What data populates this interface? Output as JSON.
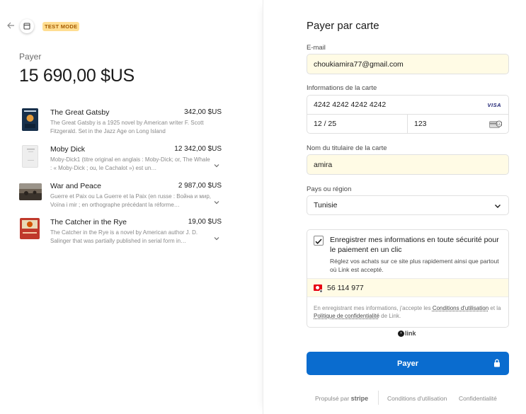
{
  "header": {
    "back_icon": "arrow-left-icon",
    "store_icon": "store-icon",
    "badge": "TEST MODE"
  },
  "summary": {
    "label": "Payer",
    "amount": "15 690,00 $US"
  },
  "items": [
    {
      "title": "The Great Gatsby",
      "price": "342,00 $US",
      "desc": "The Great Gatsby is a 1925 novel by American writer F. Scott Fitzgerald. Set in the Jazz Age on Long Island",
      "thumb_color": "#1d3a5a",
      "expandable": false
    },
    {
      "title": "Moby Dick",
      "price": "12 342,00 $US",
      "desc": "Moby-Dick1 (titre original en anglais : Moby-Dick; or, The Whale : « Moby-Dick ; ou, le Cachalot ») est un…",
      "thumb_color": "#eeeeee",
      "expandable": true
    },
    {
      "title": "War and Peace",
      "price": "2 987,00 $US",
      "desc": "Guerre et Paix ou La Guerre et la Paix (en russe : Война и мир, Voïna i mir ; en orthographe précédant la réforme…",
      "thumb_color": "#5a5248",
      "expandable": true
    },
    {
      "title": "The Catcher in the Rye",
      "price": "19,00 $US",
      "desc": "The Catcher in the Rye is a novel by American author J. D. Salinger that was partially published in serial form in…",
      "thumb_color": "#c0392b",
      "expandable": true
    }
  ],
  "form": {
    "title": "Payer par carte",
    "email_label": "E-mail",
    "email_value": "choukiamira77@gmail.com",
    "card_label": "Informations de la carte",
    "card_number": "4242 4242 4242 4242",
    "card_brand": "VISA",
    "card_expiry": "12 / 25",
    "card_cvc": "123",
    "holder_label": "Nom du titulaire de la carte",
    "holder_value": "amira",
    "country_label": "Pays ou région",
    "country_value": "Tunisie",
    "save_checked": true,
    "save_label": "Enregistrer mes informations en toute sécurité pour le paiement en un clic",
    "save_sub": "Réglez vos achats sur ce site plus rapidement ainsi que partout où Link est accepté.",
    "phone_value": "56 114 977",
    "terms_pre": "En enregistrant mes informations, j'accepte les ",
    "terms_link1": "Conditions d'utilisation",
    "terms_mid": " et la ",
    "terms_link2": "Politique de confidentialité",
    "terms_post": " de Link.",
    "link_brand": "link",
    "pay_button": "Payer"
  },
  "footer": {
    "powered_by": "Propulsé par",
    "stripe": "stripe",
    "terms": "Conditions d'utilisation",
    "privacy": "Confidentialité"
  },
  "colors": {
    "accent": "#0a6ccf",
    "autofill_bg": "#fffbe5",
    "badge_bg": "#ffde92"
  }
}
